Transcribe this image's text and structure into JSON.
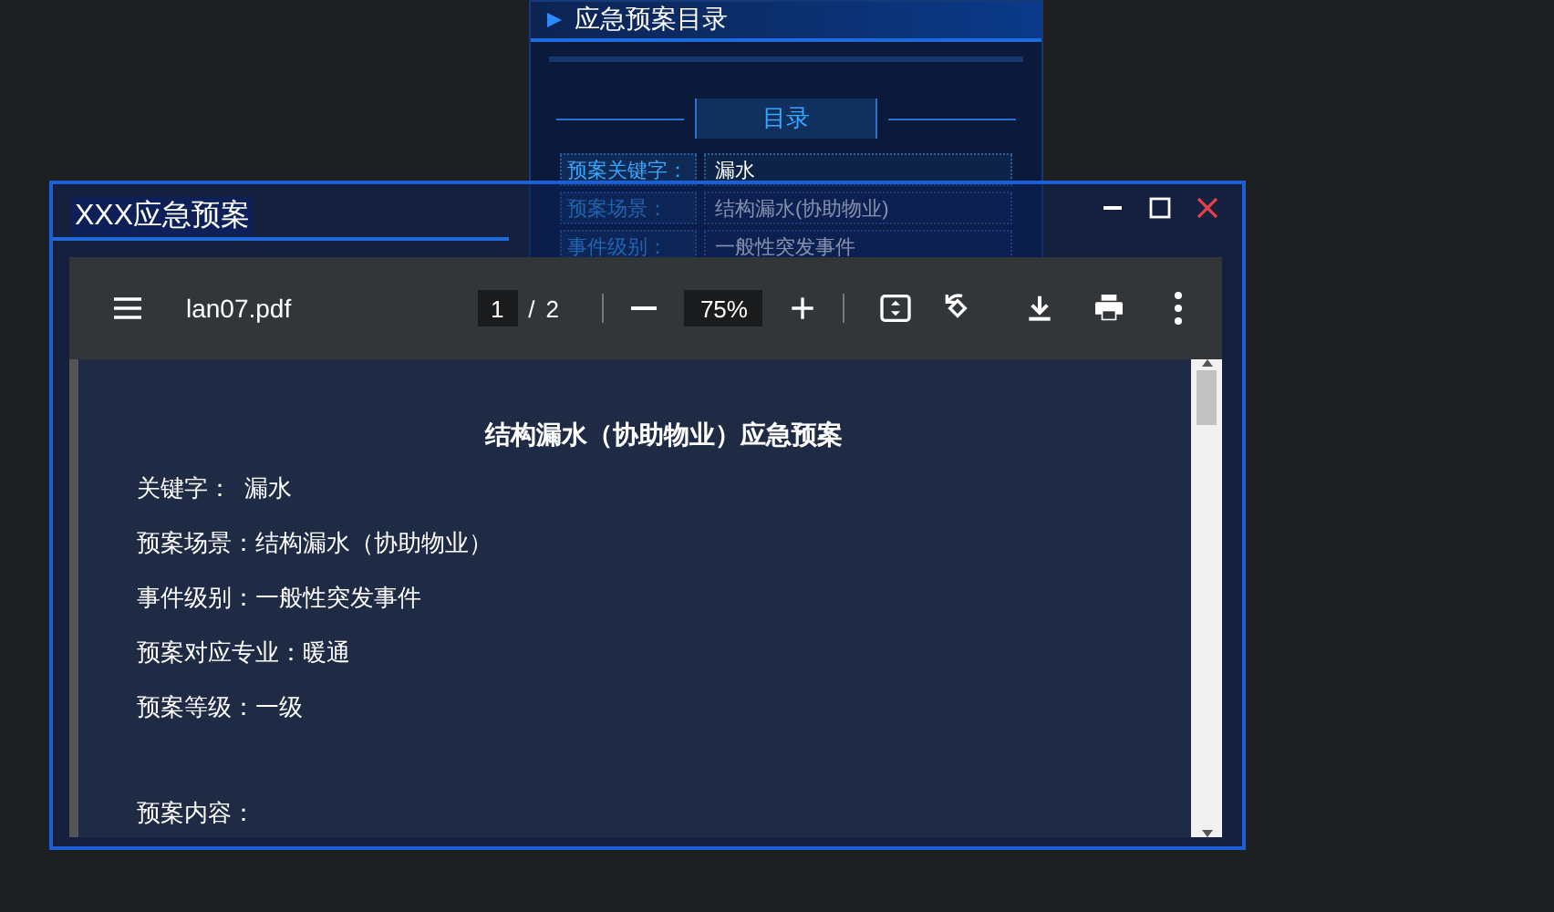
{
  "background_panel": {
    "title": "应急预案目录",
    "section": "目录",
    "fields": [
      {
        "label": "预案关键字：",
        "value": "漏水"
      },
      {
        "label": "预案场景：",
        "value": "结构漏水(协助物业)"
      },
      {
        "label": "事件级别：",
        "value": "一般性突发事件"
      }
    ]
  },
  "dialog": {
    "title": "XXX应急预案",
    "pdf_viewer": {
      "file_name": "lan07.pdf",
      "page": "1",
      "page_separator": "/",
      "page_count": "2",
      "zoom": "75%",
      "document": {
        "heading": "结构漏水（协助物业）应急预案",
        "lines": [
          {
            "kind": "field",
            "text": "关键字：  漏水"
          },
          {
            "kind": "field",
            "text": "预案场景：结构漏水（协助物业）"
          },
          {
            "kind": "field",
            "text": "事件级别：一般性突发事件"
          },
          {
            "kind": "field",
            "text": "预案对应专业：暖通"
          },
          {
            "kind": "field",
            "text": "预案等级：一级"
          },
          {
            "kind": "section",
            "text": "预案内容："
          }
        ]
      }
    }
  }
}
